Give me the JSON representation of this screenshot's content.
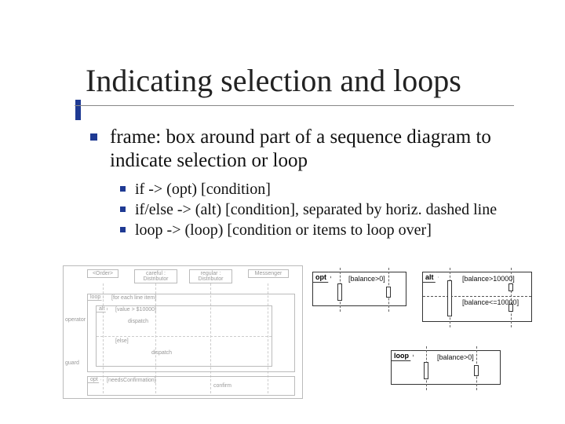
{
  "title": "Indicating selection and loops",
  "main_bullet": "frame: box around part of a sequence diagram to indicate selection or loop",
  "sub_bullets": [
    "if -> (opt) [condition]",
    "if/else -> (alt) [condition], separated by horiz. dashed line",
    "loop -> (loop) [condition or items to loop over]"
  ],
  "left_diagram": {
    "headers": [
      "<Order>",
      "careful : Distributor",
      "regular : Distributor",
      "Messenger"
    ],
    "side_labels": [
      "operator",
      "guard"
    ],
    "frames": {
      "loop_tag": "loop",
      "loop_cond": "[for each line item]",
      "alt_tag": "alt",
      "alt_cond1": "[value > $10000]",
      "alt_msg1": "dispatch",
      "alt_cond2": "[else]",
      "alt_msg2": "dispatch",
      "opt_tag": "opt",
      "opt_cond": "[needsConfirmation]",
      "opt_msg": "confirm"
    }
  },
  "opt_frame": {
    "tag": "opt",
    "cond": "[balance>0]"
  },
  "alt_frame": {
    "tag": "alt",
    "cond1": "[balance>10000]",
    "cond2": "[balance<=10000]"
  },
  "loop_frame": {
    "tag": "loop",
    "cond": "[balance>0]"
  }
}
